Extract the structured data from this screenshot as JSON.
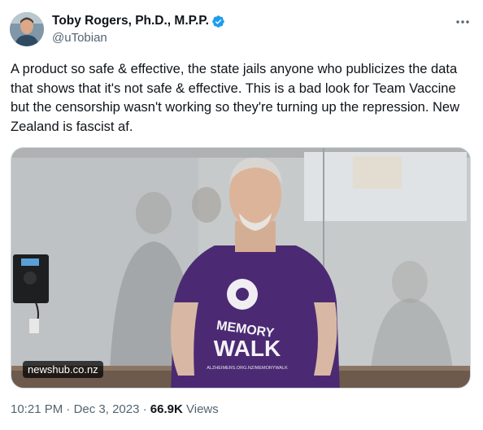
{
  "author": {
    "display_name": "Toby Rogers, Ph.D., M.P.P.",
    "handle": "@uTobian",
    "verified": true
  },
  "icons": {
    "verified": "verified-badge-icon",
    "more": "more-options-icon"
  },
  "colors": {
    "verified_blue": "#1d9bf0",
    "text_primary": "#0f1419",
    "text_secondary": "#536471"
  },
  "tweet": {
    "text": "A product so safe & effective, the state jails anyone who publicizes the data that shows that it's not safe & effective. This is a bad look for Team Vaccine but the censorship wasn't working so they're turning up the repression. New Zealand is fascist af."
  },
  "media": {
    "source_badge": "newshub.co.nz",
    "shirt_text_line1": "MEMORY",
    "shirt_text_line2": "WALK",
    "shirt_small_text": "ALZHEIMERS.ORG.NZ/MEMORYWALK"
  },
  "meta": {
    "time": "10:21 PM",
    "separator": "·",
    "date": "Dec 3, 2023",
    "views_count": "66.9K",
    "views_label": "Views"
  }
}
